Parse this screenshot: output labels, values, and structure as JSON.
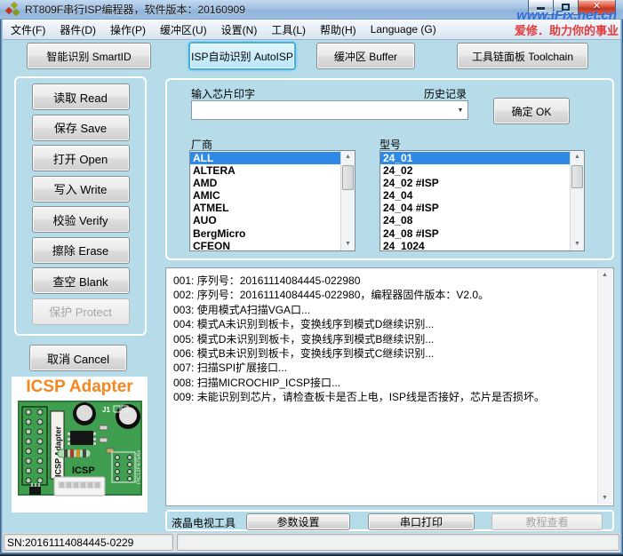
{
  "window": {
    "title": "RT809F串行ISP编程器，软件版本：20160909",
    "watermark": "www.iFix.net.cn",
    "slogan": "爱修．助力你的事业",
    "status_sn": "SN:20161114084445-0229"
  },
  "menu": {
    "items": [
      "文件(F)",
      "器件(D)",
      "操作(P)",
      "缓冲区(U)",
      "设置(N)",
      "工具(L)",
      "帮助(H)",
      "Language (G)"
    ]
  },
  "toolbar": {
    "smart_id": "智能识别 SmartID",
    "auto_isp": "ISP自动识别 AutoISP",
    "buffer": "缓冲区 Buffer",
    "toolchain": "工具链面板 Toolchain"
  },
  "sidebar": {
    "buttons": [
      "读取 Read",
      "保存 Save",
      "打开 Open",
      "写入 Write",
      "校验 Verify",
      "擦除 Erase",
      "查空 Blank",
      "保护 Protect"
    ],
    "cancel": "取消 Cancel"
  },
  "adapter": {
    "title": "ICSP Adapter",
    "board_vertical_label": "ICSP Adapter",
    "board_label": "ICSP",
    "chip_label": "PIC12F675/6x",
    "connector_label": "J1"
  },
  "chip_select": {
    "input_label": "输入芯片印字",
    "history_label": "历史记录",
    "combo_value": "",
    "ok_button": "确定 OK",
    "vendor_label": "厂商",
    "model_label": "型号",
    "selected_vendor": "ALL",
    "selected_model": "24_01",
    "vendors": [
      "ALL",
      "ALTERA",
      "AMD",
      "AMIC",
      "ATMEL",
      "AUO",
      "BergMicro",
      "CFEON"
    ],
    "models": [
      "24_01",
      "24_02",
      "24_02 #ISP",
      "24_04",
      "24_04 #ISP",
      "24_08",
      "24_08 #ISP",
      "24_1024"
    ]
  },
  "log": {
    "lines": [
      "001: 序列号：20161114084445-022980",
      "002: 序列号：20161114084445-022980，编程器固件版本：V2.0。",
      "003: 使用模式A扫描VGA口...",
      "004: 模式A未识别到板卡，变换线序到模式D继续识别...",
      "005: 模式D未识别到板卡，变换线序到模式B继续识别...",
      "006: 模式B未识别到板卡，变换线序到模式C继续识别...",
      "007: 扫描SPI扩展接口...",
      "008: 扫描MICROCHIP_ICSP接口...",
      "009: 未能识别到芯片，请检查板卡是否上电，ISP线是否接好，芯片是否损坏。"
    ]
  },
  "bottom": {
    "lcd_tools": "液晶电视工具",
    "param_settings": "参数设置",
    "serial_print": "串口打印",
    "tutorial_view": "教程查看"
  },
  "colors": {
    "client_bg": "#b6dce9",
    "selection_blue": "#2e8ae6",
    "slogan_red": "#e23b3b",
    "watermark_blue": "#2e6cd6",
    "adapter_orange": "#f5871f",
    "active_button_border": "#41b1e1"
  }
}
